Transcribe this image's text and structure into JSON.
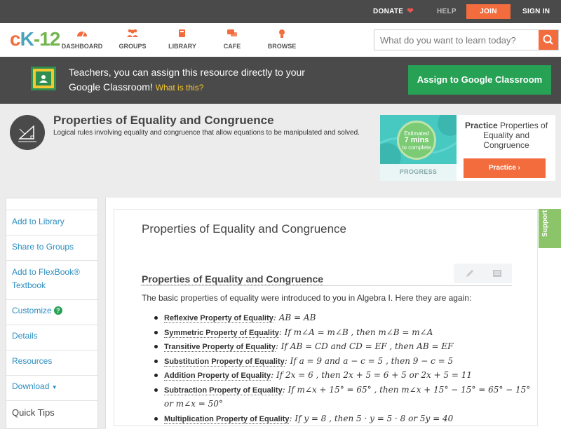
{
  "topbar": {
    "donate": "DONATE",
    "heart": "❤",
    "help": "HELP",
    "join": "JOIN",
    "signin": "SIGN IN"
  },
  "nav": {
    "logo": {
      "c": "c",
      "k": "K",
      "n": "-12"
    },
    "items": [
      {
        "label": "DASHBOARD",
        "icon": "dashboard-icon"
      },
      {
        "label": "GROUPS",
        "icon": "groups-icon"
      },
      {
        "label": "LIBRARY",
        "icon": "library-icon"
      },
      {
        "label": "CAFE",
        "icon": "cafe-icon"
      },
      {
        "label": "BROWSE",
        "icon": "browse-icon"
      }
    ],
    "search_placeholder": "What do you want to learn today?"
  },
  "classroom": {
    "text": "Teachers, you can assign this resource directly to your Google Classroom!",
    "what": "What is this?",
    "button": "Assign to Google Classroom"
  },
  "lesson": {
    "title": "Properties of Equality and Congruence",
    "description": "Logical rules involving equality and congruence that allow equations to be manipulated and solved."
  },
  "practice": {
    "est_line1": "Estimated",
    "est_mins": "7 mins",
    "est_line2": "to complete",
    "progress": "PROGRESS",
    "heading": "Practice",
    "topic": "Properties of Equality and Congruence",
    "button": "Practice"
  },
  "sidebar": {
    "add_library": "Add to Library",
    "share": "Share to Groups",
    "flexbook": "Add to FlexBook® Textbook",
    "customize": "Customize",
    "details": "Details",
    "resources": "Resources",
    "download": "Download",
    "quick_tips": "Quick Tips"
  },
  "content": {
    "title": "Properties of Equality and Congruence",
    "section_title": "Properties of Equality and Congruence",
    "intro": "The basic properties of equality were introduced to you in Algebra I. Here they are again:",
    "support": "Support",
    "props": [
      {
        "name": "Reflexive Property of Equality",
        "text": ": AB = AB"
      },
      {
        "name": "Symmetric Property of Equality",
        "text": ": If m∠A = m∠B , then m∠B = m∠A"
      },
      {
        "name": "Transitive Property of Equality",
        "text": ": If AB = CD and CD = EF , then AB = EF"
      },
      {
        "name": "Substitution Property of Equality",
        "text": ": If a = 9 and a − c = 5 , then 9 − c = 5"
      },
      {
        "name": "Addition Property of Equality",
        "text": ": If 2x = 6 , then 2x + 5 = 6 + 5  or 2x + 5 = 11"
      },
      {
        "name": "Subtraction Property of Equality",
        "text": ": If m∠x + 15° = 65° , then m∠x + 15° − 15° = 65° − 15°  or m∠x = 50°"
      },
      {
        "name": "Multiplication Property of Equality",
        "text": ": If y = 8 , then 5 · y = 5 · 8  or 5y = 40"
      }
    ]
  },
  "colors": {
    "accent": "#f26c3d",
    "google_green": "#27a154",
    "link": "#2e8ec0",
    "dark_bar": "#4a4a4a"
  }
}
